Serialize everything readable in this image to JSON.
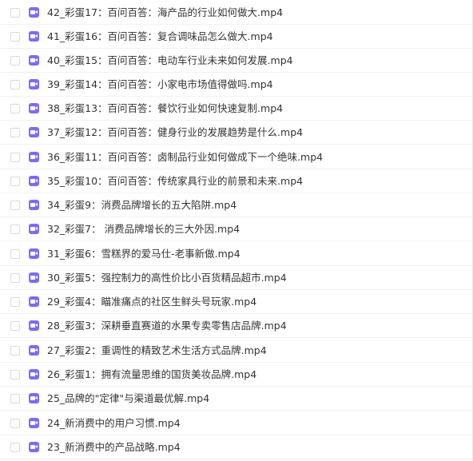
{
  "file_icon": "video-file-icon",
  "file_icon_color": "#7b6cf6",
  "files": [
    {
      "name": "42_彩蛋17：百问百答：海产品的行业如何做大.mp4"
    },
    {
      "name": "41_彩蛋16：百问百答：复合调味品怎么做大.mp4"
    },
    {
      "name": "40_彩蛋15：百问百答：电动车行业未来如何发展.mp4"
    },
    {
      "name": "39_彩蛋14：百问百答：小家电市场值得做吗.mp4"
    },
    {
      "name": "38_彩蛋13：百问百答：餐饮行业如何快速复制.mp4"
    },
    {
      "name": "37_彩蛋12：百问百答：健身行业的发展趋势是什么.mp4"
    },
    {
      "name": "36_彩蛋11：百问百答：卤制品行业如何做成下一个绝味.mp4"
    },
    {
      "name": "35_彩蛋10：百问百答：传统家具行业的前景和未来.mp4"
    },
    {
      "name": "34_彩蛋9：消费品牌增长的五大陷阱.mp4"
    },
    {
      "name": "32_彩蛋7： 消费品牌增长的三大外因.mp4"
    },
    {
      "name": "31_彩蛋6：雪糕界的爱马仕-老事新做.mp4"
    },
    {
      "name": "30_彩蛋5：强控制力的高性价比小百货精品超市.mp4"
    },
    {
      "name": "29_彩蛋4：瞄准痛点的社区生鲜头号玩家.mp4"
    },
    {
      "name": "28_彩蛋3：深耕垂直赛道的水果专卖零售店品牌.mp4"
    },
    {
      "name": "27_彩蛋2：重调性的精致艺术生活方式品牌.mp4"
    },
    {
      "name": "26_彩蛋1：拥有流量思维的国货美妆品牌.mp4"
    },
    {
      "name": "25_品牌的\"定律\"与渠道最优解.mp4"
    },
    {
      "name": "24_新消费中的用户习惯.mp4"
    },
    {
      "name": "23_新消费中的产品战略.mp4"
    }
  ]
}
